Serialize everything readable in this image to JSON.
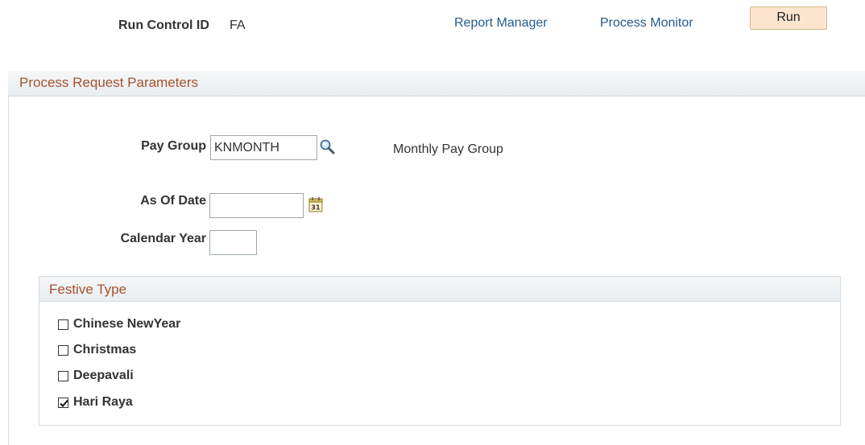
{
  "top_bar": {
    "run_control_label": "Run Control ID",
    "run_control_value": "FA",
    "report_manager_link": "Report Manager",
    "process_monitor_link": "Process Monitor",
    "run_button": "Run"
  },
  "process_request": {
    "title": "Process Request Parameters",
    "pay_group": {
      "label": "Pay Group",
      "value": "KNMONTH",
      "description": "Monthly Pay Group",
      "icon": "lookup-icon"
    },
    "as_of_date": {
      "label": "As Of Date",
      "value": "",
      "icon": "calendar-icon"
    },
    "calendar_year": {
      "label": "Calendar Year",
      "value": ""
    }
  },
  "festive_type": {
    "title": "Festive Type",
    "options": [
      {
        "label": "Chinese NewYear",
        "checked": false
      },
      {
        "label": "Christmas",
        "checked": false
      },
      {
        "label": "Deepavali",
        "checked": false
      },
      {
        "label": "Hari Raya",
        "checked": true
      }
    ]
  },
  "colors": {
    "link": "#235b8d",
    "section_title": "#a5522d",
    "run_button_bg": "#fce4cf"
  }
}
